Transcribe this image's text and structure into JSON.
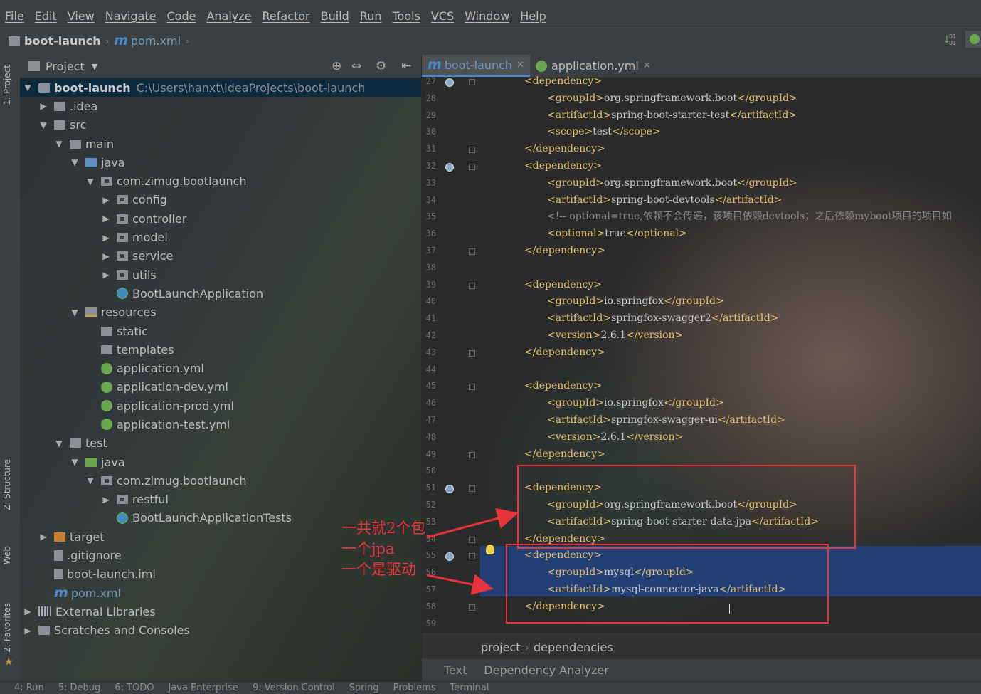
{
  "menubar": [
    "File",
    "Edit",
    "View",
    "Navigate",
    "Code",
    "Analyze",
    "Refactor",
    "Build",
    "Run",
    "Tools",
    "VCS",
    "Window",
    "Help"
  ],
  "navbar": {
    "project": "boot-launch",
    "file": "pom.xml"
  },
  "left_strip": {
    "project": "1: Project",
    "structure": "Z: Structure",
    "web": "Web",
    "favorites": "2: Favorites"
  },
  "project_panel": {
    "title": "Project",
    "tree": [
      {
        "label": "boot-launch",
        "path": "C:\\Users\\hanxt\\IdeaProjects\\boot-launch"
      },
      {
        "label": ".idea"
      },
      {
        "label": "src"
      },
      {
        "label": "main"
      },
      {
        "label": "java"
      },
      {
        "label": "com.zimug.bootlaunch"
      },
      {
        "label": "config"
      },
      {
        "label": "controller"
      },
      {
        "label": "model"
      },
      {
        "label": "service"
      },
      {
        "label": "utils"
      },
      {
        "label": "BootLaunchApplication"
      },
      {
        "label": "resources"
      },
      {
        "label": "static"
      },
      {
        "label": "templates"
      },
      {
        "label": "application.yml"
      },
      {
        "label": "application-dev.yml"
      },
      {
        "label": "application-prod.yml"
      },
      {
        "label": "application-test.yml"
      },
      {
        "label": "test"
      },
      {
        "label": "java"
      },
      {
        "label": "com.zimug.bootlaunch"
      },
      {
        "label": "restful"
      },
      {
        "label": "BootLaunchApplicationTests"
      },
      {
        "label": "target"
      },
      {
        "label": ".gitignore"
      },
      {
        "label": "boot-launch.iml"
      },
      {
        "label": "pom.xml"
      },
      {
        "label": "External Libraries"
      },
      {
        "label": "Scratches and Consoles"
      }
    ]
  },
  "editor": {
    "tabs": [
      {
        "label": "boot-launch",
        "active": true
      },
      {
        "label": "application.yml",
        "active": false
      }
    ],
    "line_numbers": [
      "27",
      "28",
      "29",
      "30",
      "31",
      "32",
      "33",
      "34",
      "35",
      "36",
      "37",
      "38",
      "39",
      "40",
      "41",
      "42",
      "43",
      "44",
      "45",
      "46",
      "47",
      "48",
      "49",
      "50",
      "51",
      "52",
      "53",
      "54",
      "55",
      "56",
      "57",
      "58",
      "59"
    ],
    "lines": [
      {
        "n": "27",
        "parts": [
          [
            "tag",
            "<dependency>"
          ]
        ]
      },
      {
        "n": "28",
        "parts": [
          [
            "tag",
            "<groupId>"
          ],
          [
            "txt",
            "org.springframework.boot"
          ],
          [
            "tag",
            "</groupId>"
          ]
        ]
      },
      {
        "n": "29",
        "parts": [
          [
            "tag",
            "<artifactId>"
          ],
          [
            "txt",
            "spring-boot-starter-test"
          ],
          [
            "tag",
            "</artifactId>"
          ]
        ]
      },
      {
        "n": "30",
        "parts": [
          [
            "tag",
            "<scope>"
          ],
          [
            "txt",
            "test"
          ],
          [
            "tag",
            "</scope>"
          ]
        ]
      },
      {
        "n": "31",
        "parts": [
          [
            "tag",
            "</dependency>"
          ]
        ]
      },
      {
        "n": "32",
        "parts": [
          [
            "tag",
            "<dependency>"
          ]
        ]
      },
      {
        "n": "33",
        "parts": [
          [
            "tag",
            "<groupId>"
          ],
          [
            "txt",
            "org.springframework.boot"
          ],
          [
            "tag",
            "</groupId>"
          ]
        ]
      },
      {
        "n": "34",
        "parts": [
          [
            "tag",
            "<artifactId>"
          ],
          [
            "txt",
            "spring-boot-devtools"
          ],
          [
            "tag",
            "</artifactId>"
          ]
        ]
      },
      {
        "n": "35",
        "parts": [
          [
            "cmt",
            "<!-- optional=true,依赖不会传递，该项目依赖devtools；之后依赖myboot项目的项目如"
          ]
        ]
      },
      {
        "n": "36",
        "parts": [
          [
            "tag",
            "<optional>"
          ],
          [
            "txt",
            "true"
          ],
          [
            "tag",
            "</optional>"
          ]
        ]
      },
      {
        "n": "37",
        "parts": [
          [
            "tag",
            "</dependency>"
          ]
        ]
      },
      {
        "n": "38",
        "parts": []
      },
      {
        "n": "39",
        "parts": [
          [
            "tag",
            "<dependency>"
          ]
        ]
      },
      {
        "n": "40",
        "parts": [
          [
            "tag",
            "<groupId>"
          ],
          [
            "txt",
            "io.springfox"
          ],
          [
            "tag",
            "</groupId>"
          ]
        ]
      },
      {
        "n": "41",
        "parts": [
          [
            "tag",
            "<artifactId>"
          ],
          [
            "txt",
            "springfox-swagger2"
          ],
          [
            "tag",
            "</artifactId>"
          ]
        ]
      },
      {
        "n": "42",
        "parts": [
          [
            "tag",
            "<version>"
          ],
          [
            "txt",
            "2.6.1"
          ],
          [
            "tag",
            "</version>"
          ]
        ]
      },
      {
        "n": "43",
        "parts": [
          [
            "tag",
            "</dependency>"
          ]
        ]
      },
      {
        "n": "44",
        "parts": []
      },
      {
        "n": "45",
        "parts": [
          [
            "tag",
            "<dependency>"
          ]
        ]
      },
      {
        "n": "46",
        "parts": [
          [
            "tag",
            "<groupId>"
          ],
          [
            "txt",
            "io.springfox"
          ],
          [
            "tag",
            "</groupId>"
          ]
        ]
      },
      {
        "n": "47",
        "parts": [
          [
            "tag",
            "<artifactId>"
          ],
          [
            "txt",
            "springfox-swagger-ui"
          ],
          [
            "tag",
            "</artifactId>"
          ]
        ]
      },
      {
        "n": "48",
        "parts": [
          [
            "tag",
            "<version>"
          ],
          [
            "txt",
            "2.6.1"
          ],
          [
            "tag",
            "</version>"
          ]
        ]
      },
      {
        "n": "49",
        "parts": [
          [
            "tag",
            "</dependency>"
          ]
        ]
      },
      {
        "n": "50",
        "parts": []
      },
      {
        "n": "51",
        "parts": [
          [
            "tag",
            "<dependency>"
          ]
        ]
      },
      {
        "n": "52",
        "parts": [
          [
            "tag",
            "<groupId>"
          ],
          [
            "txt",
            "org.springframework.boot"
          ],
          [
            "tag",
            "</groupId>"
          ]
        ]
      },
      {
        "n": "53",
        "parts": [
          [
            "tag",
            "<artifactId>"
          ],
          [
            "txt",
            "spring-boot-starter-data-jpa"
          ],
          [
            "tag",
            "</artifactId>"
          ]
        ]
      },
      {
        "n": "54",
        "parts": [
          [
            "tag",
            "</dependency>"
          ]
        ]
      },
      {
        "n": "55",
        "parts": [
          [
            "tag",
            "<dependency>"
          ]
        ]
      },
      {
        "n": "56",
        "parts": [
          [
            "tag",
            "<groupId>"
          ],
          [
            "txt",
            "mysql"
          ],
          [
            "tag",
            "</groupId>"
          ]
        ]
      },
      {
        "n": "57",
        "parts": [
          [
            "tag",
            "<artifactId>"
          ],
          [
            "txt",
            "mysql-connector-java"
          ],
          [
            "tag",
            "</artifactId>"
          ]
        ]
      },
      {
        "n": "58",
        "parts": [
          [
            "tag",
            "</dependency>"
          ]
        ]
      },
      {
        "n": "59",
        "parts": []
      }
    ],
    "breadcrumbs": [
      "project",
      "dependencies"
    ],
    "bottom_tabs": [
      "Text",
      "Dependency Analyzer"
    ]
  },
  "annotation": [
    "一共就2个包",
    "一个jpa",
    "一个是驱动"
  ],
  "tool_windows": [
    "4: Run",
    "5: Debug",
    "6: TODO",
    "Java Enterprise",
    "9: Version Control",
    "Spring",
    "Problems",
    "Terminal"
  ],
  "colors": {
    "accent": "#4a88c7",
    "annotation_red": "#e8333a",
    "xml_tag": "#e8bf6a",
    "selection": "#214283"
  }
}
